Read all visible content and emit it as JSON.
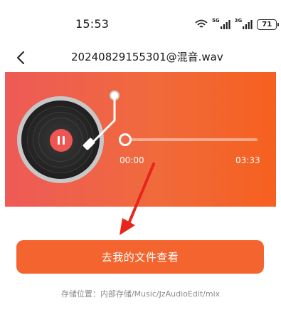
{
  "status_bar": {
    "time": "15:53",
    "network_labels": [
      "5G",
      "3G"
    ],
    "battery": "71",
    "icons": [
      "wifi-icon",
      "signal-icon",
      "signal-icon",
      "battery-icon"
    ]
  },
  "nav": {
    "back_icon": "chevron-left-icon",
    "title": "20240829155301@混音.wav"
  },
  "player": {
    "state": "paused",
    "play_icon": "pause-icon",
    "progress_fraction": 0.0,
    "current_time": "00:00",
    "duration": "03:33",
    "colors": {
      "gradient_start": "#ee5a57",
      "gradient_end": "#f6601f",
      "accent": "#ee5553"
    }
  },
  "action": {
    "label": "去我的文件查看",
    "color": "#f4642f"
  },
  "footer": {
    "save_path": "存储位置：内部存储/Music/JzAudioEdit/mix"
  }
}
